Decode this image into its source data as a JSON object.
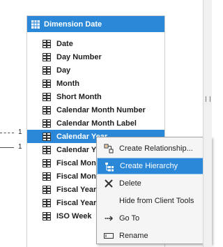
{
  "table": {
    "title": "Dimension Date",
    "columns": [
      "Date",
      "Day Number",
      "Day",
      "Month",
      "Short Month",
      "Calendar Month Number",
      "Calendar Month Label",
      "Calendar Year",
      "Calendar Y",
      "Fiscal Mont",
      "Fiscal Mont",
      "Fiscal Year",
      "Fiscal Year",
      "ISO Week"
    ],
    "selected_column": "Calendar Year"
  },
  "relationships": {
    "label_top": "1",
    "label_bottom": "1"
  },
  "context_menu": {
    "items": [
      {
        "label": "Create Relationship...",
        "icon": "create-relationship-icon"
      },
      {
        "label": "Create Hierarchy",
        "icon": "hierarchy-icon"
      },
      {
        "label": "Delete",
        "icon": "delete-x-icon"
      },
      {
        "label": "Hide from Client Tools",
        "icon": ""
      },
      {
        "label": "Go To",
        "icon": "go-to-icon"
      },
      {
        "label": "Rename",
        "icon": "rename-icon"
      }
    ],
    "highlighted": "Create Hierarchy"
  },
  "colors": {
    "accent": "#2b88d8",
    "menu_bg": "#f5f5f5"
  }
}
